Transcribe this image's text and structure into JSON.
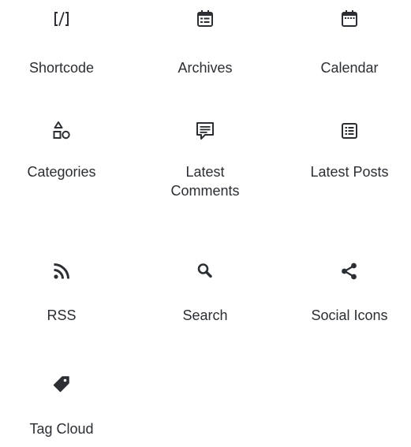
{
  "blocks": [
    {
      "label": "Shortcode",
      "icon": "shortcode-icon"
    },
    {
      "label": "Archives",
      "icon": "archives-icon"
    },
    {
      "label": "Calendar",
      "icon": "calendar-icon"
    },
    {
      "label": "Categories",
      "icon": "categories-icon"
    },
    {
      "label": "Latest\nComments",
      "icon": "latest-comments-icon"
    },
    {
      "label": "Latest Posts",
      "icon": "latest-posts-icon"
    },
    {
      "label": "RSS",
      "icon": "rss-icon"
    },
    {
      "label": "Search",
      "icon": "search-icon"
    },
    {
      "label": "Social Icons",
      "icon": "social-icons-icon"
    },
    {
      "label": "Tag Cloud",
      "icon": "tag-cloud-icon"
    }
  ],
  "colors": {
    "icon": "#2b2f33",
    "text": "#2b2f33",
    "background": "#ffffff"
  }
}
